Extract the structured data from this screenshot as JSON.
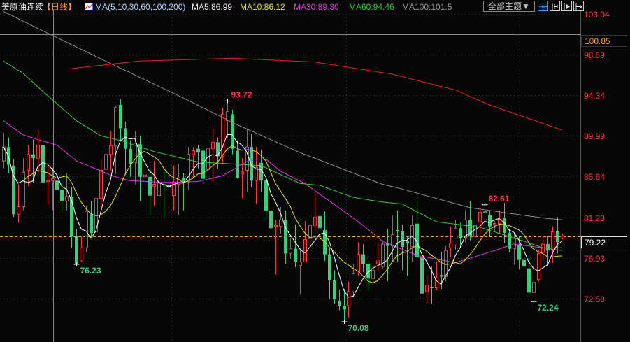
{
  "header": {
    "symbol": "美原油连续",
    "period": "【日线】",
    "indicator_icon": "line-chart-icon",
    "ma_spec": "MA(5,10,30,60,100,200)",
    "ma5": "MA5:86.99",
    "ma10": "MA10:86.12",
    "ma30": "MA30:89.30",
    "ma60": "MA60:94.46",
    "ma100": "MA100:101.5",
    "theme_button": "全部主题▼"
  },
  "toolbar_icons": [
    "crosshair-icon",
    "zoom-range-icon",
    "play-forward-icon",
    "move-right-icon"
  ],
  "colors": {
    "up": "#ff3345",
    "down": "#3dcc7e",
    "ma5": "#ffffff",
    "ma10": "#e6e600",
    "ma30": "#e633e6",
    "ma60": "#33cc33",
    "ma100": "#8c8c8c",
    "ma200": "#e62020",
    "last": "#ff9a1f"
  },
  "chart_data": {
    "type": "candlestick",
    "title": "美原油连续 【日线】",
    "y_ticks": [
      "103.04",
      "98.69",
      "94.34",
      "89.99",
      "85.64",
      "81.28",
      "76.93",
      "72.58"
    ],
    "ylim": [
      69.5,
      103.04
    ],
    "crosshair_price": "100.85",
    "last_price": "79.22",
    "annotations": [
      {
        "index": 46,
        "price": 93.72,
        "label": "93.72",
        "kind": "high"
      },
      {
        "index": 15,
        "price": 76.23,
        "label": "76.23",
        "kind": "low"
      },
      {
        "index": 70,
        "price": 70.08,
        "label": "70.08",
        "kind": "low"
      },
      {
        "index": 99,
        "price": 82.61,
        "label": "82.61",
        "kind": "high"
      },
      {
        "index": 109,
        "price": 72.24,
        "label": "72.24",
        "kind": "low"
      }
    ],
    "ohlc": [
      [
        87.3,
        90.3,
        86.5,
        88.8
      ],
      [
        88.8,
        89.8,
        86.0,
        86.9
      ],
      [
        86.8,
        87.5,
        81.3,
        81.6
      ],
      [
        81.6,
        84.8,
        80.7,
        82.4
      ],
      [
        82.4,
        87.6,
        82.0,
        86.1
      ],
      [
        86.3,
        89.0,
        84.6,
        88.0
      ],
      [
        88.0,
        89.6,
        85.0,
        87.6
      ],
      [
        87.6,
        90.6,
        86.0,
        89.0
      ],
      [
        89.0,
        89.5,
        84.3,
        85.0
      ],
      [
        85.1,
        86.8,
        82.6,
        85.2
      ],
      [
        85.2,
        86.6,
        82.0,
        85.4
      ],
      [
        85.2,
        86.4,
        82.5,
        84.2
      ],
      [
        84.2,
        85.6,
        82.0,
        83.0
      ],
      [
        83.0,
        86.0,
        82.0,
        83.5
      ],
      [
        83.5,
        84.5,
        78.0,
        79.2
      ],
      [
        79.2,
        80.0,
        76.23,
        76.3
      ],
      [
        76.6,
        79.2,
        76.5,
        78.0
      ],
      [
        78.0,
        82.5,
        77.5,
        81.9
      ],
      [
        81.6,
        83.0,
        79.0,
        79.6
      ],
      [
        79.7,
        86.0,
        79.3,
        83.3
      ],
      [
        83.3,
        87.5,
        82.0,
        86.3
      ],
      [
        86.4,
        88.6,
        85.0,
        88.0
      ],
      [
        88.0,
        90.5,
        86.3,
        88.9
      ],
      [
        88.9,
        93.2,
        85.9,
        93.0
      ],
      [
        93.3,
        93.9,
        89.5,
        90.8
      ],
      [
        90.8,
        91.5,
        85.8,
        88.6
      ],
      [
        88.6,
        89.5,
        85.6,
        87.0
      ],
      [
        87.1,
        90.5,
        84.8,
        89.2
      ],
      [
        89.1,
        90.0,
        83.0,
        85.6
      ],
      [
        85.6,
        86.7,
        84.5,
        85.8
      ],
      [
        85.6,
        86.6,
        81.5,
        83.6
      ],
      [
        84.6,
        87.3,
        82.5,
        84.8
      ],
      [
        83.6,
        86.8,
        81.5,
        85.0
      ],
      [
        84.8,
        86.5,
        81.3,
        84.7
      ],
      [
        84.7,
        87.0,
        82.0,
        84.5
      ],
      [
        83.6,
        86.8,
        82.0,
        85.0
      ],
      [
        84.8,
        87.0,
        81.5,
        85.5
      ],
      [
        85.5,
        86.0,
        82.0,
        85.0
      ],
      [
        85.1,
        88.8,
        84.2,
        88.0
      ],
      [
        88.0,
        88.8,
        85.5,
        88.4
      ],
      [
        88.6,
        89.0,
        86.5,
        88.2
      ],
      [
        88.4,
        88.9,
        84.8,
        85.4
      ],
      [
        86.4,
        91.0,
        85.0,
        88.6
      ],
      [
        88.6,
        90.8,
        85.0,
        89.3
      ],
      [
        89.3,
        89.8,
        86.5,
        87.8
      ],
      [
        87.8,
        93.0,
        87.0,
        92.3
      ],
      [
        91.6,
        93.72,
        89.8,
        92.6
      ],
      [
        92.3,
        92.8,
        88.0,
        88.6
      ],
      [
        88.4,
        89.5,
        85.4,
        85.5
      ],
      [
        85.9,
        87.6,
        83.3,
        86.1
      ],
      [
        86.3,
        90.8,
        84.0,
        88.8
      ],
      [
        88.8,
        90.2,
        84.5,
        85.2
      ],
      [
        85.2,
        88.8,
        82.7,
        86.6
      ],
      [
        87.1,
        88.5,
        84.0,
        85.2
      ],
      [
        85.2,
        85.5,
        81.0,
        82.0
      ],
      [
        82.0,
        83.0,
        75.5,
        80.1
      ],
      [
        80.3,
        81.0,
        75.1,
        80.4
      ],
      [
        80.3,
        82.4,
        79.5,
        81.0
      ],
      [
        81.0,
        82.0,
        76.3,
        77.4
      ],
      [
        77.4,
        79.0,
        76.8,
        77.9
      ],
      [
        77.9,
        80.5,
        75.9,
        76.5
      ],
      [
        76.1,
        78.0,
        73.0,
        76.5
      ],
      [
        76.5,
        80.9,
        76.5,
        78.9
      ],
      [
        79.0,
        81.5,
        78.5,
        80.4
      ],
      [
        80.4,
        84.0,
        79.8,
        81.3
      ],
      [
        81.4,
        81.5,
        78.5,
        80.1
      ],
      [
        79.9,
        81.9,
        76.6,
        77.3
      ],
      [
        77.3,
        78.0,
        72.5,
        74.5
      ],
      [
        74.5,
        75.6,
        72.0,
        72.5
      ],
      [
        72.3,
        73.5,
        71.3,
        71.8
      ],
      [
        71.8,
        73.6,
        70.08,
        71.4
      ],
      [
        71.8,
        74.4,
        70.5,
        73.3
      ],
      [
        73.3,
        76.3,
        72.8,
        75.2
      ],
      [
        75.3,
        78.6,
        75.0,
        77.3
      ],
      [
        77.3,
        78.4,
        75.4,
        76.3
      ],
      [
        76.3,
        76.6,
        73.5,
        74.7
      ],
      [
        74.7,
        76.7,
        74.0,
        75.6
      ],
      [
        76.3,
        78.5,
        75.5,
        76.6
      ],
      [
        76.0,
        78.8,
        75.8,
        78.4
      ],
      [
        78.5,
        80.0,
        74.4,
        78.2
      ],
      [
        78.2,
        81.5,
        76.6,
        79.4
      ],
      [
        79.9,
        82.0,
        76.5,
        79.8
      ],
      [
        79.8,
        80.5,
        75.6,
        78.1
      ],
      [
        78.7,
        79.3,
        75.0,
        78.5
      ],
      [
        78.1,
        81.5,
        76.5,
        80.4
      ],
      [
        80.6,
        83.1,
        77.0,
        77.0
      ],
      [
        77.0,
        77.5,
        72.5,
        73.1
      ],
      [
        73.3,
        75.1,
        72.1,
        74.0
      ],
      [
        73.8,
        76.0,
        72.0,
        73.7
      ],
      [
        73.7,
        76.5,
        73.5,
        74.8
      ],
      [
        75.1,
        77.6,
        73.6,
        74.9
      ],
      [
        74.9,
        78.2,
        74.4,
        77.7
      ],
      [
        78.0,
        80.3,
        77.0,
        78.5
      ],
      [
        78.3,
        81.0,
        77.8,
        80.1
      ],
      [
        80.1,
        80.7,
        78.0,
        79.0
      ],
      [
        79.1,
        82.0,
        78.6,
        81.0
      ],
      [
        81.0,
        83.0,
        78.8,
        79.2
      ],
      [
        79.2,
        81.5,
        78.0,
        80.4
      ],
      [
        80.8,
        82.1,
        79.5,
        81.8
      ],
      [
        81.9,
        82.61,
        80.8,
        81.8
      ],
      [
        81.5,
        82.0,
        79.2,
        80.3
      ],
      [
        80.5,
        80.9,
        79.8,
        80.6
      ],
      [
        80.6,
        82.0,
        79.5,
        81.2
      ],
      [
        81.2,
        82.8,
        78.5,
        79.6
      ],
      [
        79.6,
        80.0,
        77.5,
        77.9
      ],
      [
        77.9,
        79.6,
        76.2,
        79.0
      ],
      [
        78.3,
        79.3,
        75.7,
        76.7
      ],
      [
        76.7,
        77.5,
        74.6,
        76.0
      ],
      [
        75.8,
        77.2,
        73.0,
        73.2
      ],
      [
        73.2,
        74.6,
        72.24,
        74.3
      ],
      [
        74.6,
        77.8,
        74.4,
        77.4
      ],
      [
        77.5,
        79.0,
        76.6,
        78.4
      ],
      [
        78.4,
        79.3,
        76.0,
        77.7
      ],
      [
        77.8,
        80.3,
        76.4,
        79.7
      ],
      [
        79.8,
        81.3,
        77.4,
        78.6
      ],
      [
        79.0,
        79.5,
        78.9,
        79.22
      ]
    ],
    "ma_lines": {
      "ma200": [
        [
          14,
          97.2
        ],
        [
          28,
          98.0
        ],
        [
          47,
          98.3
        ],
        [
          64,
          97.9
        ],
        [
          80,
          96.6
        ],
        [
          93,
          94.9
        ],
        [
          100,
          93.3
        ],
        [
          115,
          90.6
        ]
      ],
      "ma100": [
        [
          0,
          103.3
        ],
        [
          9,
          101.0
        ],
        [
          21,
          98.0
        ],
        [
          38,
          93.8
        ],
        [
          48,
          91.2
        ],
        [
          61,
          88.2
        ],
        [
          72,
          86.0
        ],
        [
          78,
          84.8
        ],
        [
          82,
          84.3
        ],
        [
          96,
          82.3
        ],
        [
          111,
          81.2
        ],
        [
          115,
          81.0
        ]
      ],
      "ma60": [
        [
          0,
          98.0
        ],
        [
          4,
          96.7
        ],
        [
          8,
          94.8
        ],
        [
          15,
          91.6
        ],
        [
          20,
          90.0
        ],
        [
          24,
          89.5
        ],
        [
          31,
          88.3
        ],
        [
          40,
          87.2
        ],
        [
          53,
          86.8
        ],
        [
          61,
          84.9
        ],
        [
          65,
          84.7
        ],
        [
          72,
          83.4
        ],
        [
          78,
          82.9
        ],
        [
          82,
          82.7
        ],
        [
          89,
          80.8
        ],
        [
          98,
          80.2
        ],
        [
          106,
          78.9
        ],
        [
          111,
          78.0
        ],
        [
          115,
          77.7
        ]
      ],
      "ma30": [
        [
          0,
          91.6
        ],
        [
          4,
          90.1
        ],
        [
          7,
          89.6
        ],
        [
          11,
          89.0
        ],
        [
          15,
          87.3
        ],
        [
          23,
          85.6
        ],
        [
          26,
          85.2
        ],
        [
          33,
          85.0
        ],
        [
          40,
          85.1
        ],
        [
          45,
          85.7
        ],
        [
          51,
          87.5
        ],
        [
          54,
          87.5
        ],
        [
          57,
          86.2
        ],
        [
          62,
          84.9
        ],
        [
          69,
          82.3
        ],
        [
          74,
          80.4
        ],
        [
          78,
          78.7
        ],
        [
          85,
          77.2
        ],
        [
          93,
          76.4
        ],
        [
          101,
          77.7
        ],
        [
          105,
          78.4
        ],
        [
          111,
          78.0
        ],
        [
          115,
          78.0
        ]
      ]
    },
    "computed_ma_periods": {
      "ma5": 5,
      "ma10": 10
    }
  }
}
